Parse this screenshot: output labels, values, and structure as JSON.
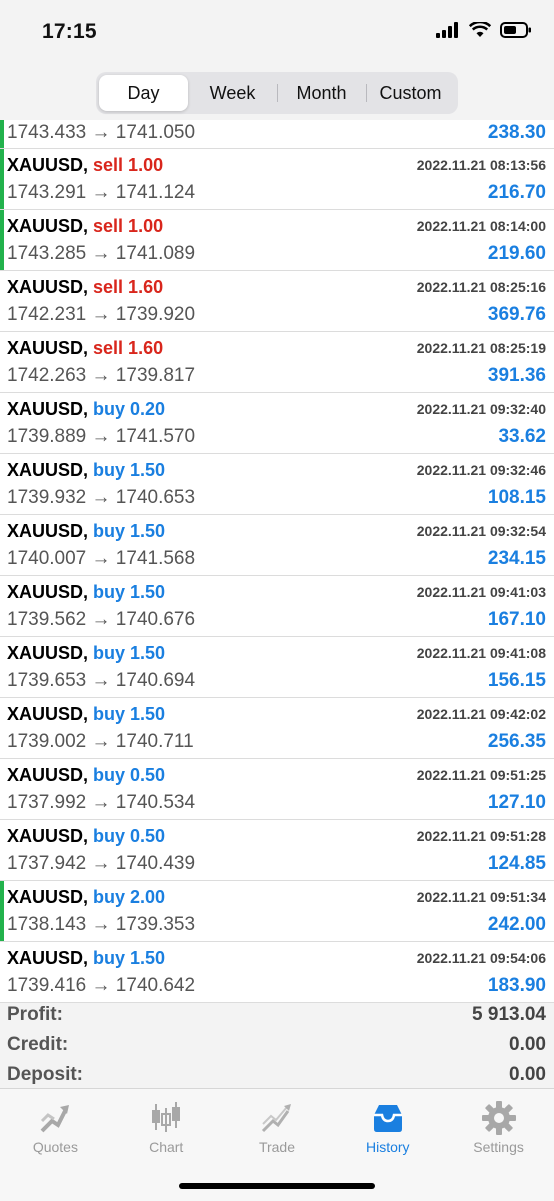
{
  "status": {
    "time": "17:15"
  },
  "periods": [
    {
      "label": "Day",
      "active": true
    },
    {
      "label": "Week",
      "active": false
    },
    {
      "label": "Month",
      "active": false
    },
    {
      "label": "Custom",
      "active": false
    }
  ],
  "partial_row": {
    "prices": "1743.433 → 1741.050",
    "profit": "238.30"
  },
  "deals": [
    {
      "symbol": "XAUUSD,",
      "type": "sell 1.00",
      "dir": "sell",
      "time": "2022.11.21 08:13:56",
      "prices": "1743.291 → 1741.124",
      "profit": "216.70",
      "marked": true
    },
    {
      "symbol": "XAUUSD,",
      "type": "sell 1.00",
      "dir": "sell",
      "time": "2022.11.21 08:14:00",
      "prices": "1743.285 → 1741.089",
      "profit": "219.60",
      "marked": true
    },
    {
      "symbol": "XAUUSD,",
      "type": "sell 1.60",
      "dir": "sell",
      "time": "2022.11.21 08:25:16",
      "prices": "1742.231 → 1739.920",
      "profit": "369.76",
      "marked": false
    },
    {
      "symbol": "XAUUSD,",
      "type": "sell 1.60",
      "dir": "sell",
      "time": "2022.11.21 08:25:19",
      "prices": "1742.263 → 1739.817",
      "profit": "391.36",
      "marked": false
    },
    {
      "symbol": "XAUUSD,",
      "type": "buy 0.20",
      "dir": "buy",
      "time": "2022.11.21 09:32:40",
      "prices": "1739.889 → 1741.570",
      "profit": "33.62",
      "marked": false
    },
    {
      "symbol": "XAUUSD,",
      "type": "buy 1.50",
      "dir": "buy",
      "time": "2022.11.21 09:32:46",
      "prices": "1739.932 → 1740.653",
      "profit": "108.15",
      "marked": false
    },
    {
      "symbol": "XAUUSD,",
      "type": "buy 1.50",
      "dir": "buy",
      "time": "2022.11.21 09:32:54",
      "prices": "1740.007 → 1741.568",
      "profit": "234.15",
      "marked": false
    },
    {
      "symbol": "XAUUSD,",
      "type": "buy 1.50",
      "dir": "buy",
      "time": "2022.11.21 09:41:03",
      "prices": "1739.562 → 1740.676",
      "profit": "167.10",
      "marked": false
    },
    {
      "symbol": "XAUUSD,",
      "type": "buy 1.50",
      "dir": "buy",
      "time": "2022.11.21 09:41:08",
      "prices": "1739.653 → 1740.694",
      "profit": "156.15",
      "marked": false
    },
    {
      "symbol": "XAUUSD,",
      "type": "buy 1.50",
      "dir": "buy",
      "time": "2022.11.21 09:42:02",
      "prices": "1739.002 → 1740.711",
      "profit": "256.35",
      "marked": false
    },
    {
      "symbol": "XAUUSD,",
      "type": "buy 0.50",
      "dir": "buy",
      "time": "2022.11.21 09:51:25",
      "prices": "1737.992 → 1740.534",
      "profit": "127.10",
      "marked": false
    },
    {
      "symbol": "XAUUSD,",
      "type": "buy 0.50",
      "dir": "buy",
      "time": "2022.11.21 09:51:28",
      "prices": "1737.942 → 1740.439",
      "profit": "124.85",
      "marked": false
    },
    {
      "symbol": "XAUUSD,",
      "type": "buy 2.00",
      "dir": "buy",
      "time": "2022.11.21 09:51:34",
      "prices": "1738.143 → 1739.353",
      "profit": "242.00",
      "marked": true
    },
    {
      "symbol": "XAUUSD,",
      "type": "buy 1.50",
      "dir": "buy",
      "time": "2022.11.21 09:54:06",
      "prices": "1739.416 → 1740.642",
      "profit": "183.90",
      "marked": false
    }
  ],
  "summary": [
    {
      "label": "Profit:",
      "value": "5 913.04"
    },
    {
      "label": "Credit:",
      "value": "0.00"
    },
    {
      "label": "Deposit:",
      "value": "0.00"
    }
  ],
  "tabs": [
    {
      "label": "Quotes",
      "icon": "quotes-icon",
      "active": false
    },
    {
      "label": "Chart",
      "icon": "chart-icon",
      "active": false
    },
    {
      "label": "Trade",
      "icon": "trade-icon",
      "active": false
    },
    {
      "label": "History",
      "icon": "history-icon",
      "active": true
    },
    {
      "label": "Settings",
      "icon": "settings-icon",
      "active": false
    }
  ],
  "colors": {
    "accent": "#1a7fe0",
    "sell": "#d9261c",
    "marker": "#22b24c"
  }
}
